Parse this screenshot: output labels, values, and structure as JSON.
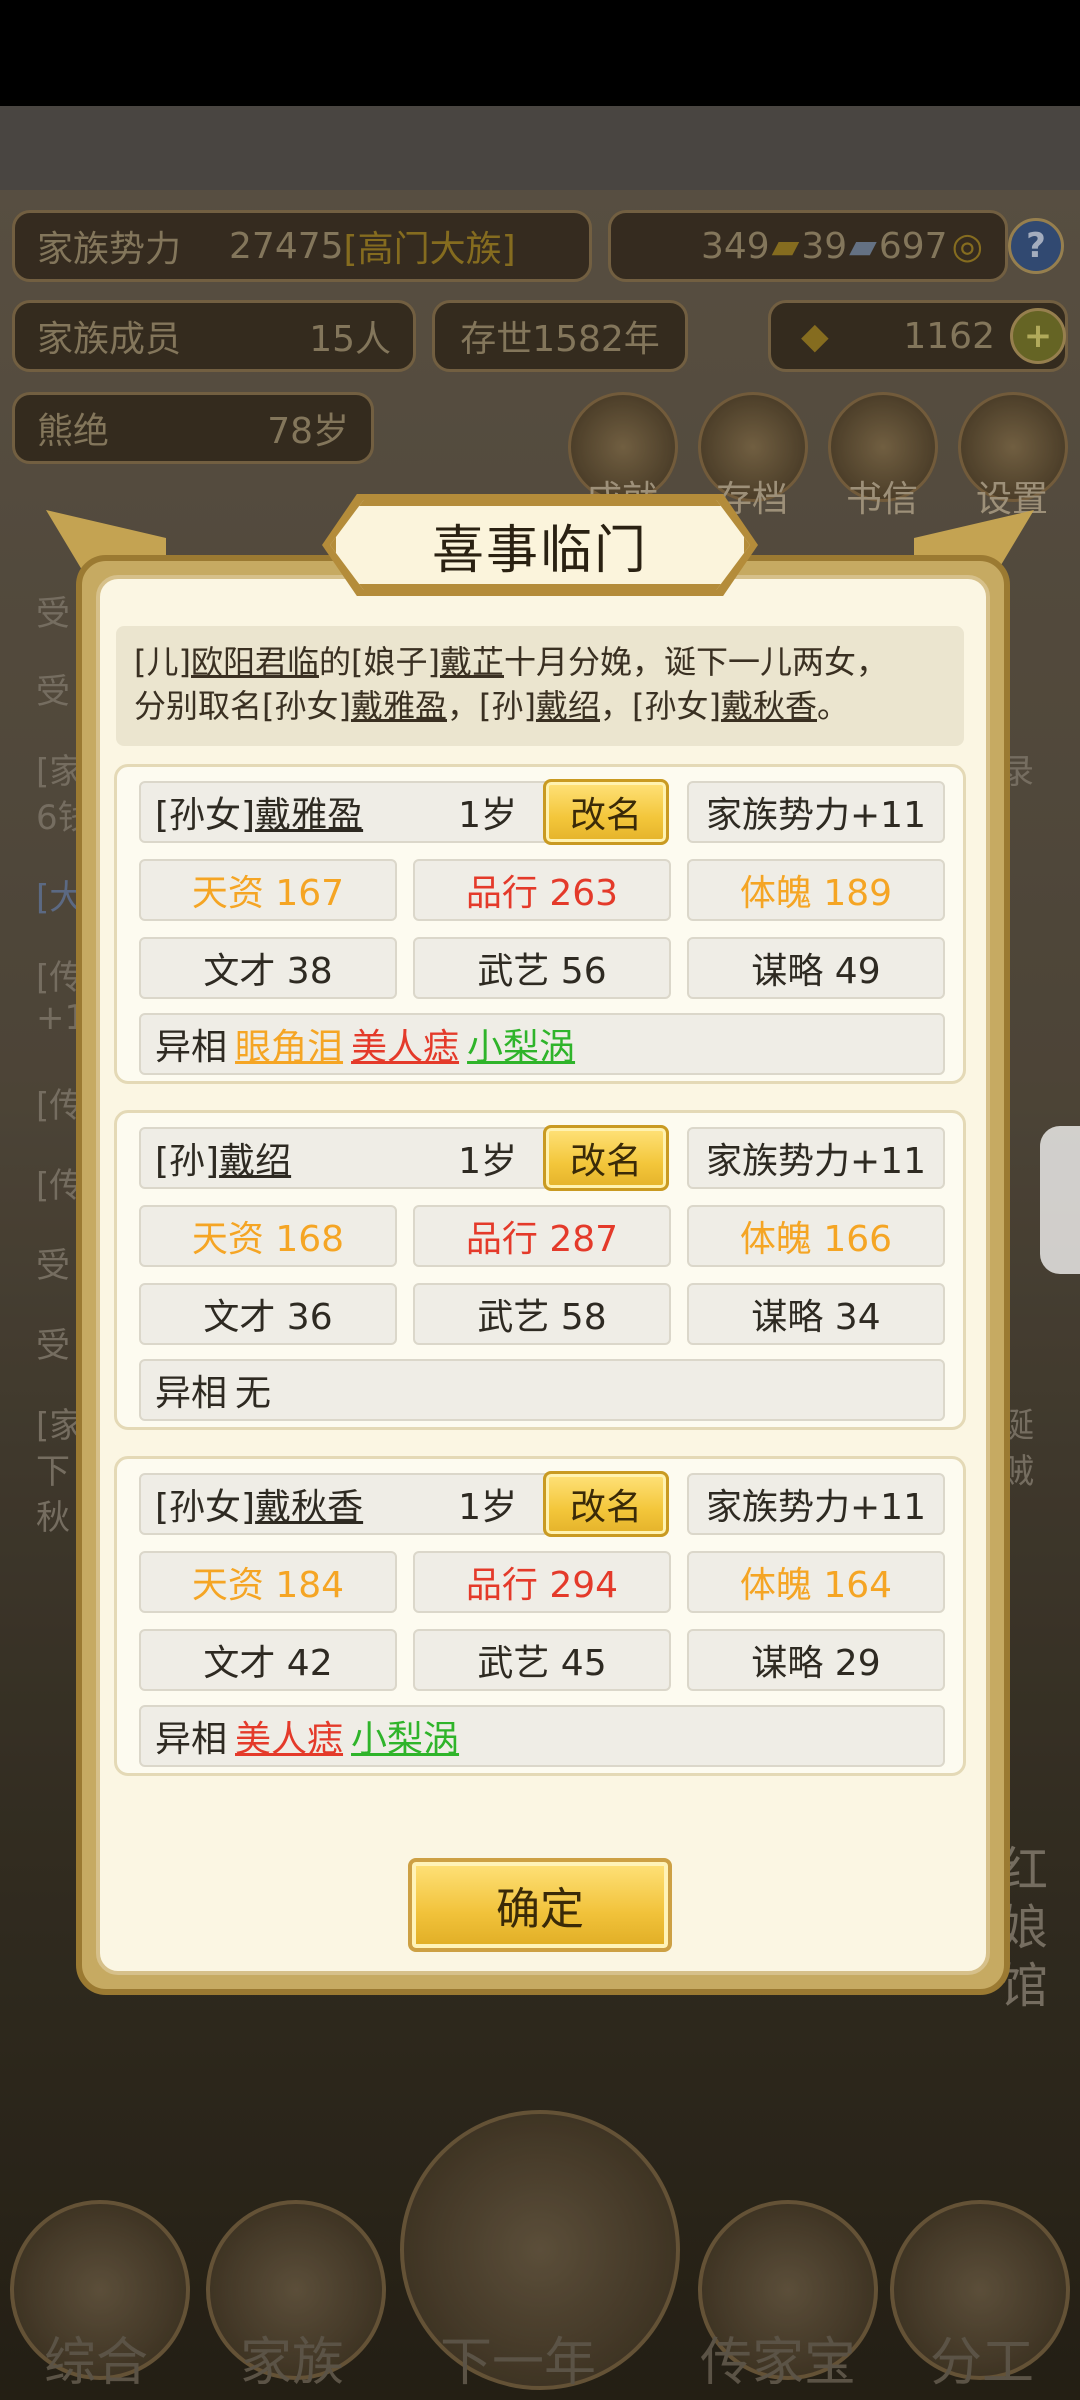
{
  "hud": {
    "clan_power_label": "家族势力",
    "clan_power_value": "27475",
    "clan_rank": "[高门大族]",
    "resource_1": "349",
    "resource_2": "39",
    "resource_3": "697",
    "help": "?",
    "members_label": "家族成员",
    "members_value": "15人",
    "existence": "存世1582年",
    "gold": "1162",
    "plus": "+",
    "leader_name": "熊绝",
    "leader_age": "78岁",
    "menu": [
      "成就",
      "存档",
      "书信",
      "设置"
    ]
  },
  "background": {
    "log_fragments": [
      "受",
      "受",
      "[家",
      "6钱",
      "[大",
      "[传",
      "+1",
      "[传",
      "[传",
      "受",
      "受",
      "[家",
      "下",
      "秋"
    ],
    "right_fragments": [
      "录",
      "诞",
      "贼"
    ],
    "side_building": [
      "红",
      "娘",
      "馆"
    ],
    "bottom_nav": [
      "综合",
      "家族",
      "下一年",
      "传家宝",
      "分工"
    ]
  },
  "dialog": {
    "title": "喜事临门",
    "announce_line1_parts": [
      "[儿]",
      "欧阳君临",
      "的[娘子]",
      "戴芷",
      "十月分娩，诞下一儿两女，"
    ],
    "announce_line2_parts": [
      "分别取名[孙女]",
      "戴雅盈",
      "，[孙]",
      "戴绍",
      "，[孙女]",
      "戴秋香",
      "。"
    ],
    "children": [
      {
        "relation": "[孙女]",
        "name": "戴雅盈",
        "age": "1岁",
        "rename": "改名",
        "clan_power": "家族势力+11",
        "talent": "天资 167",
        "morality": "品行 263",
        "physique": "体魄 189",
        "literacy": "文才 38",
        "martial": "武艺 56",
        "strategy": "谋略 49",
        "traits_label": "异相",
        "traits": [
          {
            "text": "眼角泪",
            "color": "#f5a524"
          },
          {
            "text": "美人痣",
            "color": "#e43a2a"
          },
          {
            "text": "小梨涡",
            "color": "#2fb42a"
          }
        ]
      },
      {
        "relation": "[孙]",
        "name": "戴绍",
        "age": "1岁",
        "rename": "改名",
        "clan_power": "家族势力+11",
        "talent": "天资 168",
        "morality": "品行 287",
        "physique": "体魄 166",
        "literacy": "文才 36",
        "martial": "武艺 58",
        "strategy": "谋略 34",
        "traits_label": "异相",
        "traits_none": "无",
        "traits": []
      },
      {
        "relation": "[孙女]",
        "name": "戴秋香",
        "age": "1岁",
        "rename": "改名",
        "clan_power": "家族势力+11",
        "talent": "天资 184",
        "morality": "品行 294",
        "physique": "体魄 164",
        "literacy": "文才 42",
        "martial": "武艺 45",
        "strategy": "谋略 29",
        "traits_label": "异相",
        "traits": [
          {
            "text": "美人痣",
            "color": "#e43a2a"
          },
          {
            "text": "小梨涡",
            "color": "#2fb42a"
          }
        ]
      }
    ],
    "confirm": "确定"
  }
}
